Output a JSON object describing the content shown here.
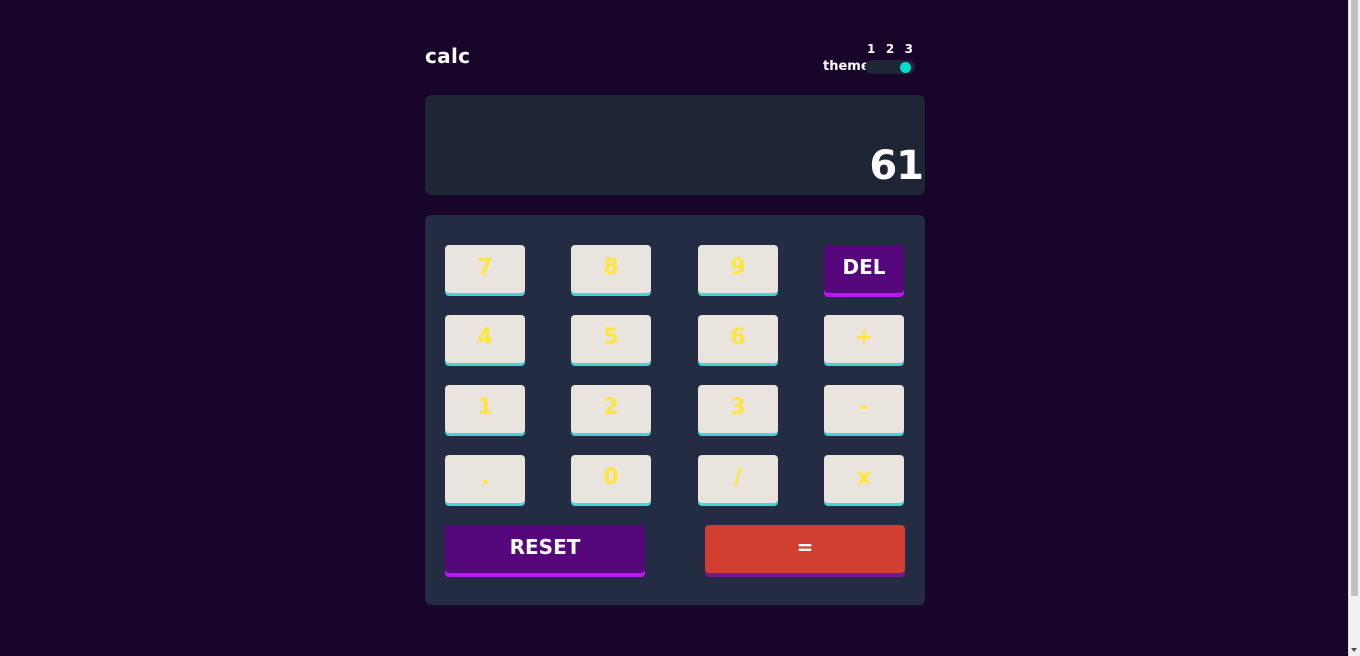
{
  "header": {
    "logo": "calc",
    "theme_label": "theme",
    "theme_options": [
      "1",
      "2",
      "3"
    ],
    "theme_selected": "3"
  },
  "screen": {
    "value": "61"
  },
  "keys": {
    "row1": [
      "7",
      "8",
      "9",
      "DEL"
    ],
    "row2": [
      "4",
      "5",
      "6",
      "+"
    ],
    "row3": [
      "1",
      "2",
      "3",
      "-"
    ],
    "row4": [
      ".",
      "0",
      "/",
      "x"
    ],
    "reset": "RESET",
    "equals": "="
  },
  "colors": {
    "background": "#17062a",
    "screen": "#1e2535",
    "keypad": "#232c43",
    "key": "#e9e4dd",
    "key_text": "#ffe53d",
    "accent_purple": "#56077c",
    "accent_red": "#d03f2f",
    "toggle_knob": "#00dece"
  }
}
